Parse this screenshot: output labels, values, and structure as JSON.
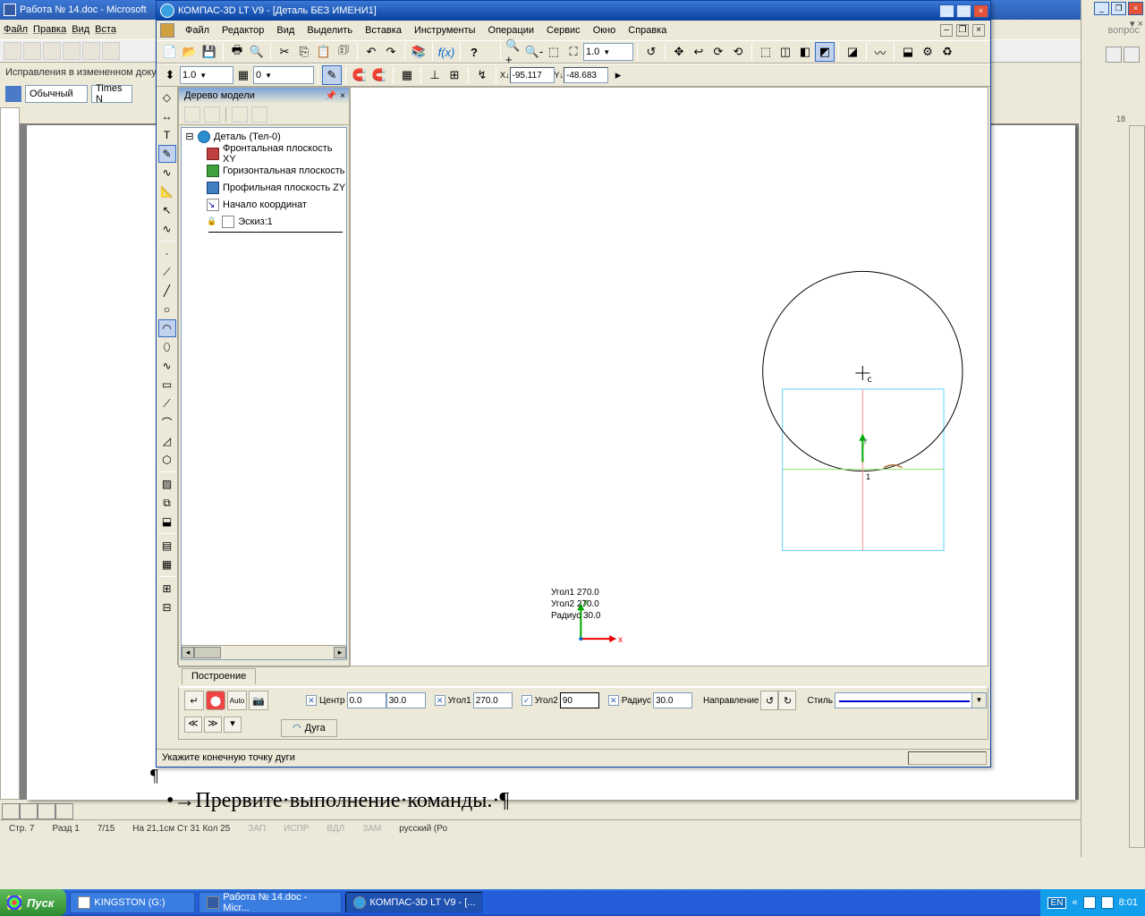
{
  "word": {
    "title": "Работа № 14.doc - Microsoft",
    "menu": [
      "Файл",
      "Правка",
      "Вид",
      "Вста"
    ],
    "tb2_text": "Исправления в измененном доку",
    "style_label": "Обычный",
    "font_label": "Times N",
    "body_text": "•→Прервите·выполнение·команды.·¶",
    "status": {
      "page": "Стр. 7",
      "sect": "Разд 1",
      "pages": "7/15",
      "pos": "На 21,1см  Ст 31   Кол 25",
      "zap": "ЗАП",
      "ispr": "ИСПР",
      "vdl": "ВДЛ",
      "zam": "ЗАМ",
      "lang": "русский (Ро"
    }
  },
  "right": {
    "vopros": "вопрос",
    "ruler_num": "18"
  },
  "kompas": {
    "title": "КОМПАС-3D LT V9 - [Деталь БЕЗ ИМЕНИ1]",
    "menu": [
      "Файл",
      "Редактор",
      "Вид",
      "Выделить",
      "Вставка",
      "Инструменты",
      "Операции",
      "Сервис",
      "Окно",
      "Справка"
    ],
    "scale": "1.0",
    "layer": "0",
    "view_scale": "1.0",
    "coord_x": "-95.117",
    "coord_y": "-48.683",
    "tree": {
      "title": "Дерево модели",
      "root": "Деталь (Тел-0)",
      "items": [
        "Фронтальная плоскость XY",
        "Горизонтальная плоскость",
        "Профильная плоскость ZY",
        "Начало координат",
        "Эскиз:1"
      ]
    },
    "tab_build": "Построение",
    "hints": {
      "u1": "Угол1  270.0",
      "u2": "Угол2  270.0",
      "r": "Радиус 30.0"
    },
    "axes": {
      "x": "x",
      "y": "y"
    },
    "origin_label": "1",
    "cursor_c": "c",
    "prop": {
      "center_lbl": "Центр",
      "center_x": "0.0",
      "center_y": "30.0",
      "u1_lbl": "Угол1",
      "u1": "270.0",
      "u2_lbl": "Угол2",
      "u2": "90",
      "r_lbl": "Радиус",
      "r": "30.0",
      "dir_lbl": "Направление",
      "style_lbl": "Стиль",
      "tab": "Дуга"
    },
    "status": "Укажите конечную точку дуги"
  },
  "taskbar": {
    "start": "Пуск",
    "items": [
      "KINGSTON (G:)",
      "Работа № 14.doc - Micr...",
      "КОМПАС-3D LT V9 - [..."
    ],
    "lang": "EN",
    "time": "8:01"
  }
}
